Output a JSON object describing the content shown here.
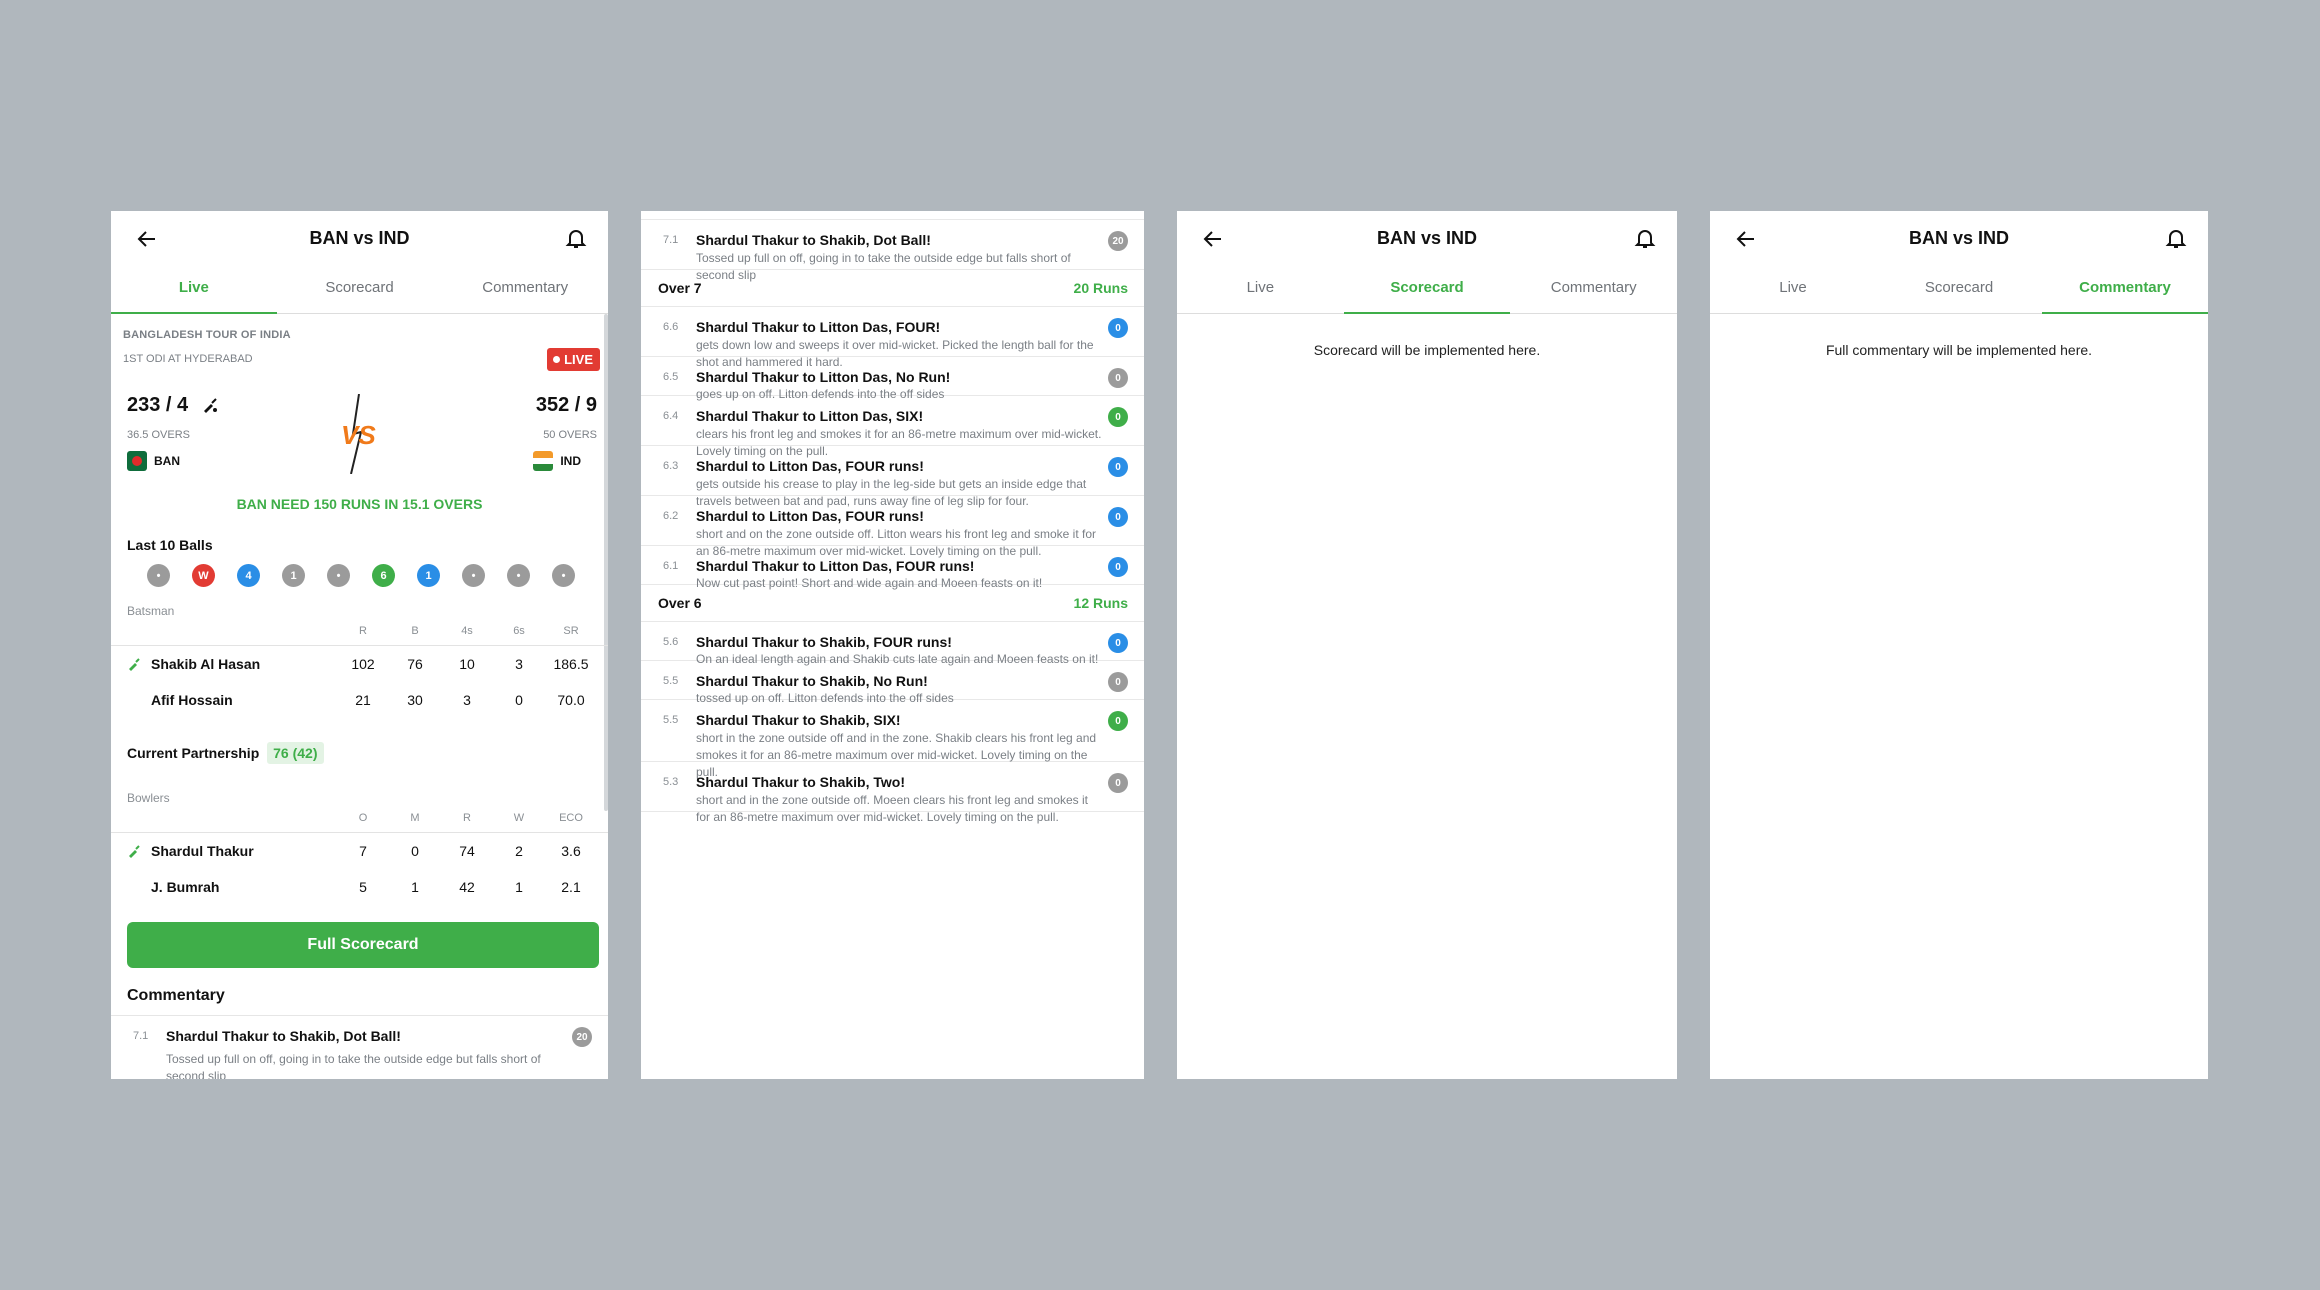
{
  "screens": {
    "live": {
      "title": "BAN vs IND",
      "tabs": [
        "Live",
        "Scorecard",
        "Commentary"
      ],
      "series": "BANGLADESH TOUR OF INDIA",
      "venue": "1ST ODI AT HYDERABAD",
      "live_badge": "LIVE",
      "team1": {
        "score": "233 / 4",
        "overs": "36.5 OVERS",
        "name": "BAN"
      },
      "team2": {
        "score": "352 / 9",
        "overs": "50 OVERS",
        "name": "IND"
      },
      "need_text": "BAN NEED 150 RUNS IN 15.1 OVERS",
      "last_balls_label": "Last 10 Balls",
      "last_balls": [
        "•",
        "W",
        "4",
        "1",
        "•",
        "6",
        "1",
        "•",
        "•",
        "•"
      ],
      "batsman_label": "Batsman",
      "bat_headers": [
        "R",
        "B",
        "4s",
        "6s",
        "SR"
      ],
      "batsmen": [
        {
          "name": "Shakib Al Hasan",
          "values": [
            "102",
            "76",
            "10",
            "3",
            "186.5"
          ]
        },
        {
          "name": "Afif Hossain",
          "values": [
            "21",
            "30",
            "3",
            "0",
            "70.0"
          ]
        }
      ],
      "partnership_label": "Current Partnership",
      "partnership_value": "76 (42)",
      "bowlers_label": "Bowlers",
      "bowl_headers": [
        "O",
        "M",
        "R",
        "W",
        "ECO"
      ],
      "bowlers": [
        {
          "name": "Shardul Thakur",
          "values": [
            "7",
            "0",
            "74",
            "2",
            "3.6"
          ]
        },
        {
          "name": "J. Bumrah",
          "values": [
            "5",
            "1",
            "42",
            "1",
            "2.1"
          ]
        }
      ],
      "full_scorecard_button": "Full Scorecard",
      "commentary_title": "Commentary",
      "commentary_preview": {
        "num": "7.1",
        "title": "Shardul Thakur to Shakib, Dot Ball!",
        "desc": "Tossed up full on off, going in to take the outside edge but falls short of second slip",
        "runs": "20"
      }
    },
    "commentary_list": {
      "items": [
        {
          "type": "entry",
          "num": "7.1",
          "title": "Shardul Thakur to Shakib, Dot Ball!",
          "desc": "Tossed up full on off, going in to take the outside edge but falls short of second slip",
          "runs": "20"
        },
        {
          "type": "over",
          "label": "Over 7",
          "runs": "20 Runs"
        },
        {
          "type": "entry",
          "num": "6.6",
          "title": "Shardul Thakur to Litton Das, FOUR!",
          "desc": "gets down low and sweeps it over mid-wicket. Picked the length ball for the shot and hammered it hard.",
          "runs": "0"
        },
        {
          "type": "entry",
          "num": "6.5",
          "title": "Shardul Thakur to Litton Das, No Run!",
          "desc": "goes up on off. Litton defends into the off sides",
          "runs": "0"
        },
        {
          "type": "entry",
          "num": "6.4",
          "title": "Shardul Thakur to Litton Das, SIX!",
          "desc": "clears his front leg and smokes it for an 86-metre maximum over mid-wicket. Lovely timing on the pull.",
          "runs": "0"
        },
        {
          "type": "entry",
          "num": "6.3",
          "title": "Shardul to Litton Das, FOUR runs!",
          "desc": "gets outside his crease to play in the leg-side but gets an inside edge that travels between bat and pad, runs away fine of leg slip for four.",
          "runs": "0"
        },
        {
          "type": "entry",
          "num": "6.2",
          "title": "Shardul to Litton Das, FOUR runs!",
          "desc": "short and on the zone outside off. Litton wears his front leg and smoke it for an 86-metre maximum over mid-wicket. Lovely timing on the pull.",
          "runs": "0"
        },
        {
          "type": "entry",
          "num": "6.1",
          "title": "Shardul Thakur to Litton Das, FOUR runs!",
          "desc": "Now cut past point! Short and wide again and Moeen feasts on it!",
          "runs": "0"
        },
        {
          "type": "over",
          "label": "Over 6",
          "runs": "12 Runs"
        },
        {
          "type": "entry",
          "num": "5.6",
          "title": "Shardul Thakur to Shakib, FOUR runs!",
          "desc": "On an ideal length again and Shakib cuts late again and Moeen feasts on it!",
          "runs": "0"
        },
        {
          "type": "entry",
          "num": "5.5",
          "title": "Shardul Thakur to Shakib, No Run!",
          "desc": "tossed up on off. Litton defends into the off sides",
          "runs": "0"
        },
        {
          "type": "entry",
          "num": "5.5",
          "title": "Shardul Thakur to Shakib, SIX!",
          "desc": "short in the zone outside off and in the zone. Shakib clears his front leg and smokes it for an 86-metre maximum over mid-wicket. Lovely timing on the pull.",
          "runs": "0"
        },
        {
          "type": "entry",
          "num": "5.3",
          "title": "Shardul Thakur to Shakib, Two!",
          "desc": "short and in the zone outside off. Moeen clears his front leg and smokes it for an 86-metre maximum over mid-wicket. Lovely timing on the pull.",
          "runs": "0"
        }
      ]
    },
    "scorecard": {
      "title": "BAN vs IND",
      "tabs": [
        "Live",
        "Scorecard",
        "Commentary"
      ],
      "placeholder": "Scorecard will be implemented here."
    },
    "commentary": {
      "title": "BAN vs IND",
      "tabs": [
        "Live",
        "Scorecard",
        "Commentary"
      ],
      "placeholder": "Full commentary will be implemented here."
    }
  },
  "colors": {
    "accent": "#3fae49",
    "live": "#e23b33",
    "boundary": "#2a8ee6",
    "dot": "#9b9b9b",
    "wicket": "#e23b33",
    "six": "#3fae49"
  },
  "icons": {
    "back": "arrow-left-icon",
    "bell": "bell-icon",
    "bat": "cricket-bat-icon",
    "vs": "versus-icon"
  }
}
